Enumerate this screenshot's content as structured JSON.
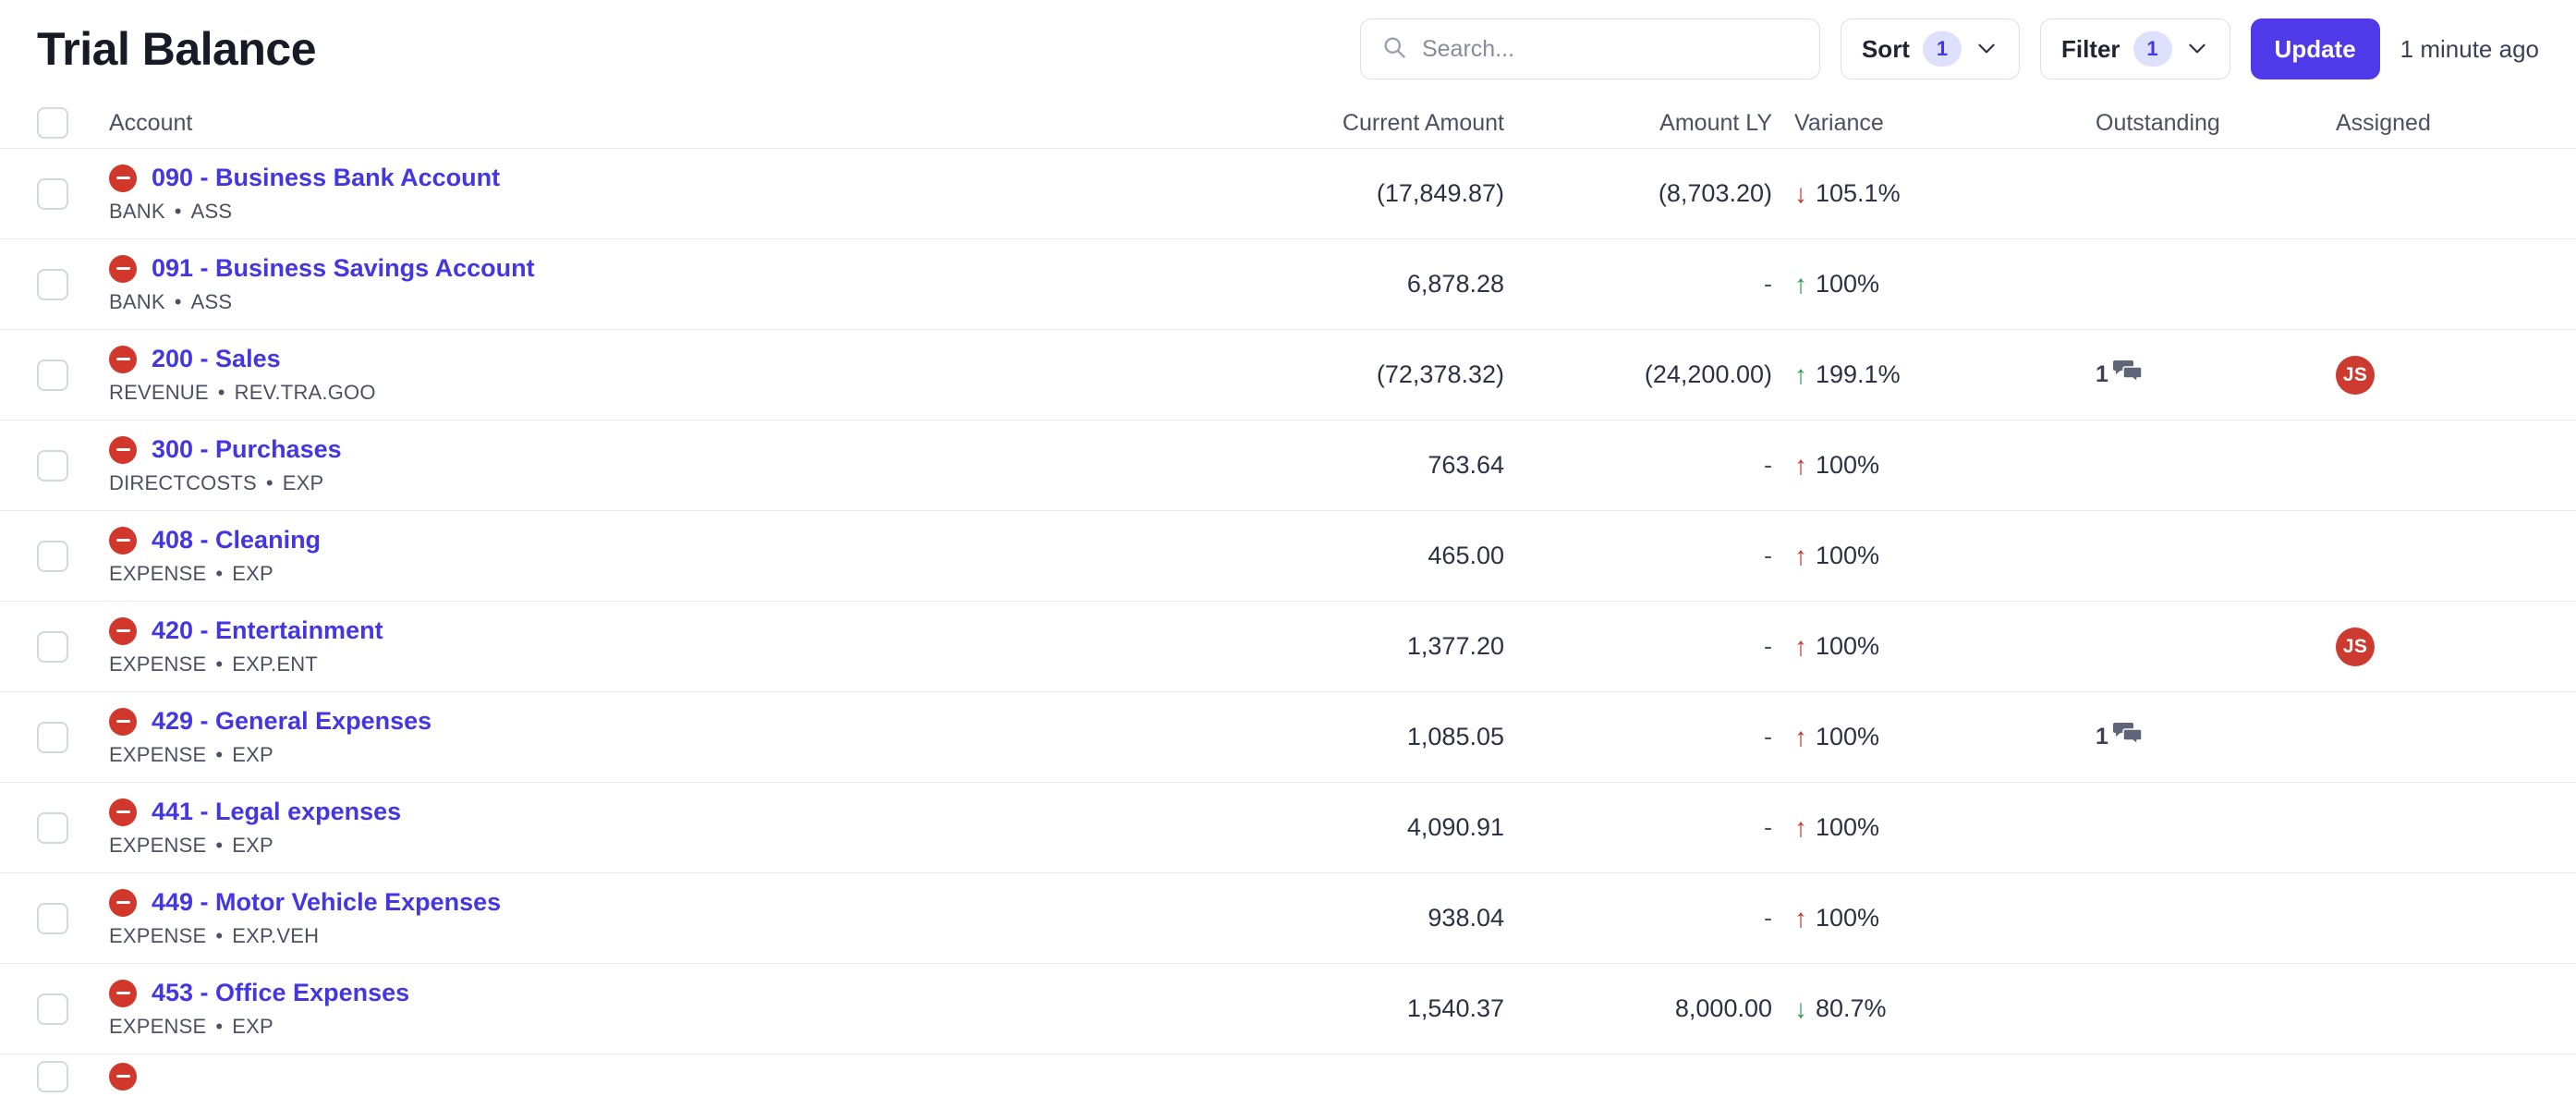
{
  "header": {
    "title": "Trial Balance",
    "search": {
      "placeholder": "Search...",
      "value": ""
    },
    "sort": {
      "label": "Sort",
      "count": "1"
    },
    "filter": {
      "label": "Filter",
      "count": "1"
    },
    "update_label": "Update",
    "timestamp": "1 minute ago"
  },
  "colors": {
    "accent": "#4f39e8",
    "link": "#4536e4",
    "badge_bg": "#dfe0fb",
    "badge_text": "#4338e8",
    "status_dot": "#d2372c",
    "avatar_bg": "#cc3a30",
    "positive": "#2e9b4f",
    "negative": "#c2342a"
  },
  "table": {
    "columns": [
      {
        "key": "account",
        "label": "Account"
      },
      {
        "key": "current_amount",
        "label": "Current Amount"
      },
      {
        "key": "amount_ly",
        "label": "Amount LY"
      },
      {
        "key": "variance",
        "label": "Variance"
      },
      {
        "key": "outstanding",
        "label": "Outstanding"
      },
      {
        "key": "assigned",
        "label": "Assigned"
      }
    ],
    "rows": [
      {
        "code": "090",
        "name": "090 - Business Bank Account",
        "type": "BANK",
        "class": "ASS",
        "current_amount": "(17,849.87)",
        "amount_ly": "(8,703.20)",
        "variance": "105.1%",
        "variance_dir": "down",
        "variance_color": "negative",
        "outstanding": "",
        "assigned": ""
      },
      {
        "code": "091",
        "name": "091 - Business Savings Account",
        "type": "BANK",
        "class": "ASS",
        "current_amount": "6,878.28",
        "amount_ly": "-",
        "variance": "100%",
        "variance_dir": "up",
        "variance_color": "positive",
        "outstanding": "",
        "assigned": ""
      },
      {
        "code": "200",
        "name": "200 - Sales",
        "type": "REVENUE",
        "class": "REV.TRA.GOO",
        "current_amount": "(72,378.32)",
        "amount_ly": "(24,200.00)",
        "variance": "199.1%",
        "variance_dir": "up",
        "variance_color": "positive",
        "outstanding": "1",
        "assigned": "JS"
      },
      {
        "code": "300",
        "name": "300 - Purchases",
        "type": "DIRECTCOSTS",
        "class": "EXP",
        "current_amount": "763.64",
        "amount_ly": "-",
        "variance": "100%",
        "variance_dir": "up",
        "variance_color": "negative",
        "outstanding": "",
        "assigned": ""
      },
      {
        "code": "408",
        "name": "408 - Cleaning",
        "type": "EXPENSE",
        "class": "EXP",
        "current_amount": "465.00",
        "amount_ly": "-",
        "variance": "100%",
        "variance_dir": "up",
        "variance_color": "negative",
        "outstanding": "",
        "assigned": ""
      },
      {
        "code": "420",
        "name": "420 - Entertainment",
        "type": "EXPENSE",
        "class": "EXP.ENT",
        "current_amount": "1,377.20",
        "amount_ly": "-",
        "variance": "100%",
        "variance_dir": "up",
        "variance_color": "negative",
        "outstanding": "",
        "assigned": "JS"
      },
      {
        "code": "429",
        "name": "429 - General Expenses",
        "type": "EXPENSE",
        "class": "EXP",
        "current_amount": "1,085.05",
        "amount_ly": "-",
        "variance": "100%",
        "variance_dir": "up",
        "variance_color": "negative",
        "outstanding": "1",
        "assigned": ""
      },
      {
        "code": "441",
        "name": "441 - Legal expenses",
        "type": "EXPENSE",
        "class": "EXP",
        "current_amount": "4,090.91",
        "amount_ly": "-",
        "variance": "100%",
        "variance_dir": "up",
        "variance_color": "negative",
        "outstanding": "",
        "assigned": ""
      },
      {
        "code": "449",
        "name": "449 - Motor Vehicle Expenses",
        "type": "EXPENSE",
        "class": "EXP.VEH",
        "current_amount": "938.04",
        "amount_ly": "-",
        "variance": "100%",
        "variance_dir": "up",
        "variance_color": "negative",
        "outstanding": "",
        "assigned": ""
      },
      {
        "code": "453",
        "name": "453 - Office Expenses",
        "type": "EXPENSE",
        "class": "EXP",
        "current_amount": "1,540.37",
        "amount_ly": "8,000.00",
        "variance": "80.7%",
        "variance_dir": "down",
        "variance_color": "positive",
        "outstanding": "",
        "assigned": ""
      }
    ]
  }
}
